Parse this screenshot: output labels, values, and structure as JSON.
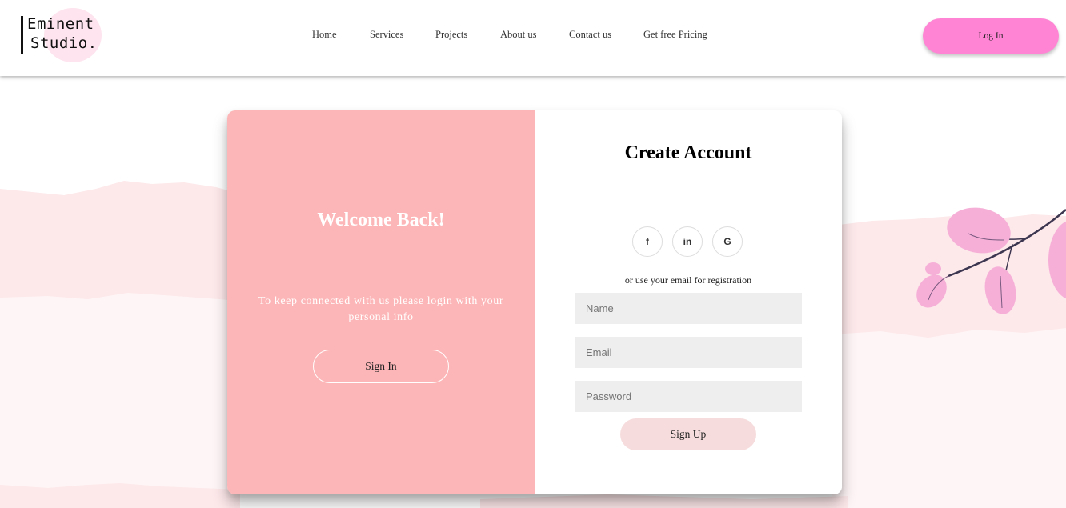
{
  "header": {
    "logo": {
      "line1": "Eminent",
      "line2": "Studio."
    },
    "nav": [
      {
        "label": "Home"
      },
      {
        "label": "Services"
      },
      {
        "label": "Projects"
      },
      {
        "label": "About us"
      },
      {
        "label": "Contact us"
      },
      {
        "label": "Get free Pricing"
      }
    ],
    "login_label": "Log In"
  },
  "welcome_panel": {
    "title": "Welcome Back!",
    "text": "To keep connected with us please login with your personal info",
    "sign_in_label": "Sign In"
  },
  "signup_panel": {
    "title": "Create Account",
    "social": [
      {
        "icon": "facebook-icon",
        "glyph": "f"
      },
      {
        "icon": "linkedin-icon",
        "glyph": "in"
      },
      {
        "icon": "google-icon",
        "glyph": "G"
      }
    ],
    "or_text": "or use your email for registration",
    "name_placeholder": "Name",
    "email_placeholder": "Email",
    "password_placeholder": "Password",
    "sign_up_label": "Sign Up"
  },
  "colors": {
    "accent_pink": "#ff85d4",
    "welcome_panel": "#fdb6b7",
    "signup_button": "#f6dcdc",
    "input_bg": "#eeeeee"
  }
}
